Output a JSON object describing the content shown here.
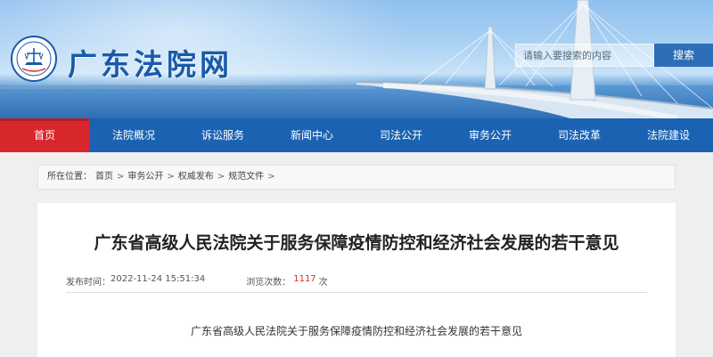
{
  "header": {
    "site_name": "广东法院网",
    "logo_icon": "court-emblem-icon",
    "search_placeholder": "请输入要搜索的内容",
    "search_button": "搜索"
  },
  "nav": {
    "items": [
      {
        "label": "首页",
        "active": true
      },
      {
        "label": "法院概况",
        "active": false
      },
      {
        "label": "诉讼服务",
        "active": false
      },
      {
        "label": "新闻中心",
        "active": false
      },
      {
        "label": "司法公开",
        "active": false
      },
      {
        "label": "审务公开",
        "active": false
      },
      {
        "label": "司法改革",
        "active": false
      },
      {
        "label": "法院建设",
        "active": false
      }
    ]
  },
  "breadcrumb": {
    "prefix": "所在位置：",
    "items": [
      "首页",
      "审务公开",
      "权威发布",
      "规范文件"
    ],
    "separator": ">"
  },
  "article": {
    "title": "广东省高级人民法院关于服务保障疫情防控和经济社会发展的若干意见",
    "publish_label": "发布时间：",
    "publish_time": "2022-11-24 15:51:34",
    "views_label": "浏览次数：",
    "views_count": "1117",
    "views_unit": "次",
    "subtitle": "广东省高级人民法院关于服务保障疫情防控和经济社会发展的若干意见"
  },
  "colors": {
    "nav_bg": "#1b63b2",
    "nav_active": "#d8282d",
    "brand_blue": "#1a5aa8",
    "search_button": "#2e6eb7",
    "views_highlight": "#d8282d"
  }
}
